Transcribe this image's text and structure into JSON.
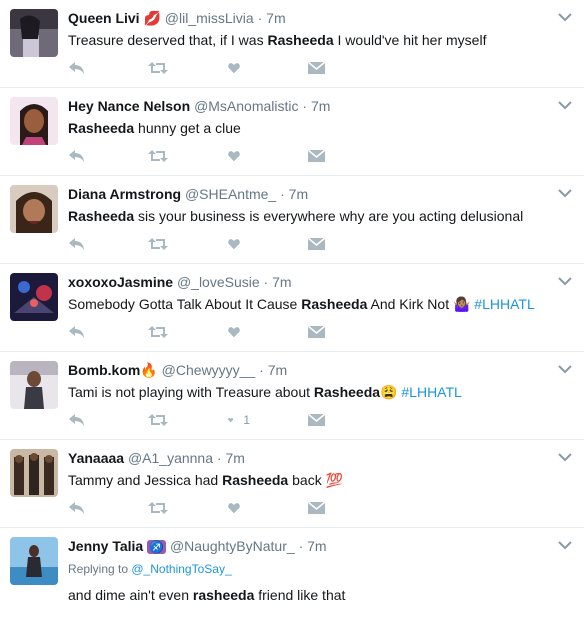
{
  "tweets": [
    {
      "fullname": "Queen Livi",
      "username": "@lil_missLivia",
      "sep": "·",
      "time": "7m",
      "text_before": "Treasure deserved that, if I was ",
      "highlight": "Rasheeda",
      "text_after": " I would've hit her myself",
      "likes": ""
    },
    {
      "fullname": "Hey Nance Nelson",
      "username": "@MsAnomalistic",
      "sep": "·",
      "time": "7m",
      "text_before": "",
      "highlight": "Rasheeda",
      "text_after": " hunny get a clue",
      "likes": ""
    },
    {
      "fullname": "Diana Armstrong",
      "username": "@SHEAntme_",
      "sep": "·",
      "time": "7m",
      "text_before": "",
      "highlight": "Rasheeda",
      "text_after": " sis your business is everywhere why are you acting delusional",
      "likes": ""
    },
    {
      "fullname": "xoxoxoJasmine",
      "username": "@_loveSusie",
      "sep": "·",
      "time": "7m",
      "text_before": "Somebody Gotta Talk About It Cause ",
      "highlight": "Rasheeda",
      "text_after": " And Kirk Not ",
      "emoji": "🤷🏽‍♀️",
      "hashtag": "#LHHATL",
      "likes": ""
    },
    {
      "fullname": "Bomb.kom",
      "name_emoji": "🔥",
      "username": "@Chewyyyy__",
      "sep": "·",
      "time": "7m",
      "text_before": "Tami is not playing with Treasure about ",
      "highlight": "Rasheeda",
      "emoji": "😩",
      "text_after": " ",
      "hashtag": "#LHHATL",
      "likes": "1"
    },
    {
      "fullname": "Yanaaaa",
      "username": "@A1_yannna",
      "sep": "·",
      "time": "7m",
      "text_before": "Tammy and Jessica had ",
      "highlight": "Rasheeda",
      "text_after": " back ",
      "emoji": "💯",
      "likes": ""
    },
    {
      "fullname": "Jenny Talia",
      "name_emoji": "♐",
      "username": "@NaughtyByNatur_",
      "sep": "·",
      "time": "7m",
      "reply_label": "Replying to ",
      "reply_to": "@_NothingToSay_",
      "text_before": "and dime ain't even ",
      "highlight": "rasheeda",
      "text_after": " friend like that"
    }
  ],
  "icons": {
    "reply": "reply-icon",
    "retweet": "retweet-icon",
    "like": "heart-icon",
    "dm": "envelope-icon",
    "caret": "chevron-down-icon"
  },
  "colors": {
    "icon": "#aab8c2",
    "link": "#1b95e0",
    "muted": "#657786",
    "divider": "#e6ecf0"
  }
}
